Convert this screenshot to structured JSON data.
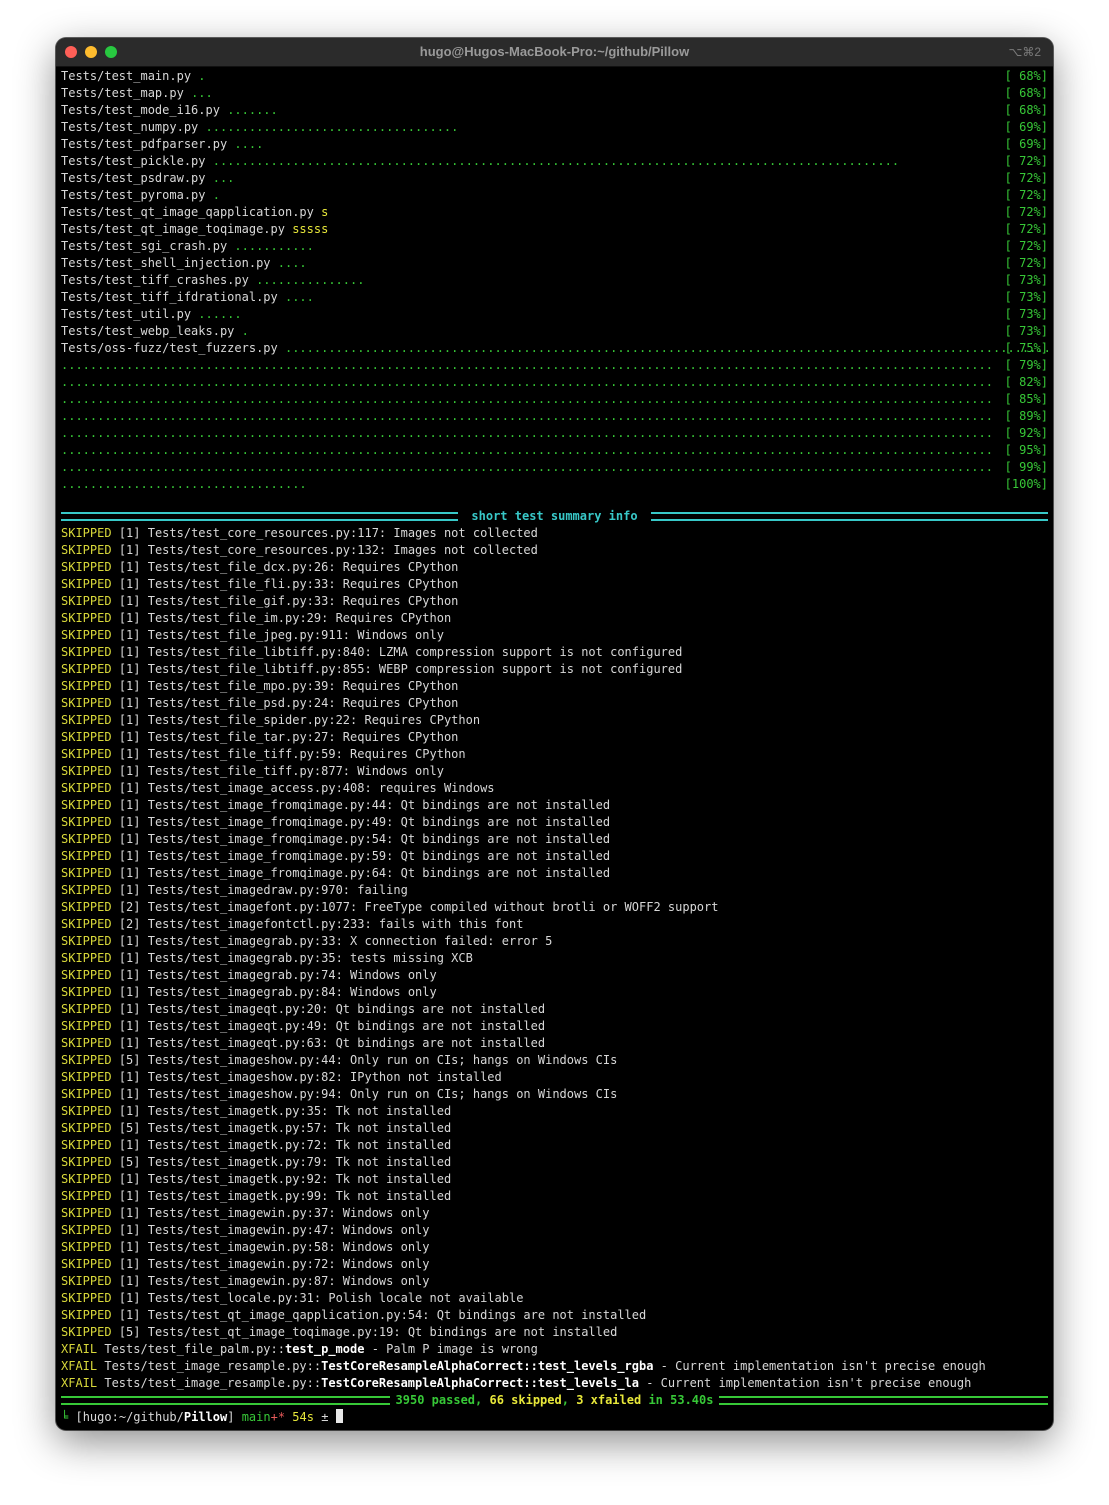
{
  "window": {
    "title": "hugo@Hugos-MacBook-Pro:~/github/Pillow",
    "shortcut": "⌥⌘2"
  },
  "progress": [
    {
      "file": "Tests/test_main.py",
      "marks": ".",
      "pct": "[ 68%]"
    },
    {
      "file": "Tests/test_map.py",
      "marks": "...",
      "pct": "[ 68%]"
    },
    {
      "file": "Tests/test_mode_i16.py",
      "marks": ".......",
      "pct": "[ 68%]"
    },
    {
      "file": "Tests/test_numpy.py",
      "marks": "...................................",
      "pct": "[ 69%]"
    },
    {
      "file": "Tests/test_pdfparser.py",
      "marks": "....",
      "pct": "[ 69%]"
    },
    {
      "file": "Tests/test_pickle.py",
      "marks": "...............................................................................................",
      "pct": "[ 72%]"
    },
    {
      "file": "Tests/test_psdraw.py",
      "marks": "...",
      "pct": "[ 72%]"
    },
    {
      "file": "Tests/test_pyroma.py",
      "marks": ".",
      "pct": "[ 72%]"
    },
    {
      "file": "Tests/test_qt_image_qapplication.py",
      "marks": "s",
      "pct": "[ 72%]",
      "skip": true
    },
    {
      "file": "Tests/test_qt_image_toqimage.py",
      "marks": "sssss",
      "pct": "[ 72%]",
      "skip": true
    },
    {
      "file": "Tests/test_sgi_crash.py",
      "marks": "...........",
      "pct": "[ 72%]"
    },
    {
      "file": "Tests/test_shell_injection.py",
      "marks": "....",
      "pct": "[ 72%]"
    },
    {
      "file": "Tests/test_tiff_crashes.py",
      "marks": "...............",
      "pct": "[ 73%]"
    },
    {
      "file": "Tests/test_tiff_ifdrational.py",
      "marks": "....",
      "pct": "[ 73%]"
    },
    {
      "file": "Tests/test_util.py",
      "marks": "......",
      "pct": "[ 73%]"
    },
    {
      "file": "Tests/test_webp_leaks.py",
      "marks": ".",
      "pct": "[ 73%]"
    },
    {
      "file": "Tests/oss-fuzz/test_fuzzers.py",
      "marks": "...........................................................................................................",
      "pct": "[ 75%]"
    }
  ],
  "fuzz_lines": [
    {
      "pct": "[ 79%]"
    },
    {
      "pct": "[ 82%]"
    },
    {
      "pct": "[ 85%]"
    },
    {
      "pct": "[ 89%]"
    },
    {
      "pct": "[ 92%]"
    },
    {
      "pct": "[ 95%]"
    },
    {
      "pct": "[ 99%]"
    }
  ],
  "fuzz_last": {
    "marks": "..................................",
    "pct": "[100%]"
  },
  "summary_header": " short test summary info ",
  "skipped_label": "SKIPPED",
  "skipped": [
    {
      "count": "[1]",
      "text": "Tests/test_core_resources.py:117: Images not collected"
    },
    {
      "count": "[1]",
      "text": "Tests/test_core_resources.py:132: Images not collected"
    },
    {
      "count": "[1]",
      "text": "Tests/test_file_dcx.py:26: Requires CPython"
    },
    {
      "count": "[1]",
      "text": "Tests/test_file_fli.py:33: Requires CPython"
    },
    {
      "count": "[1]",
      "text": "Tests/test_file_gif.py:33: Requires CPython"
    },
    {
      "count": "[1]",
      "text": "Tests/test_file_im.py:29: Requires CPython"
    },
    {
      "count": "[1]",
      "text": "Tests/test_file_jpeg.py:911: Windows only"
    },
    {
      "count": "[1]",
      "text": "Tests/test_file_libtiff.py:840: LZMA compression support is not configured"
    },
    {
      "count": "[1]",
      "text": "Tests/test_file_libtiff.py:855: WEBP compression support is not configured"
    },
    {
      "count": "[1]",
      "text": "Tests/test_file_mpo.py:39: Requires CPython"
    },
    {
      "count": "[1]",
      "text": "Tests/test_file_psd.py:24: Requires CPython"
    },
    {
      "count": "[1]",
      "text": "Tests/test_file_spider.py:22: Requires CPython"
    },
    {
      "count": "[1]",
      "text": "Tests/test_file_tar.py:27: Requires CPython"
    },
    {
      "count": "[1]",
      "text": "Tests/test_file_tiff.py:59: Requires CPython"
    },
    {
      "count": "[1]",
      "text": "Tests/test_file_tiff.py:877: Windows only"
    },
    {
      "count": "[1]",
      "text": "Tests/test_image_access.py:408: requires Windows"
    },
    {
      "count": "[1]",
      "text": "Tests/test_image_fromqimage.py:44: Qt bindings are not installed"
    },
    {
      "count": "[1]",
      "text": "Tests/test_image_fromqimage.py:49: Qt bindings are not installed"
    },
    {
      "count": "[1]",
      "text": "Tests/test_image_fromqimage.py:54: Qt bindings are not installed"
    },
    {
      "count": "[1]",
      "text": "Tests/test_image_fromqimage.py:59: Qt bindings are not installed"
    },
    {
      "count": "[1]",
      "text": "Tests/test_image_fromqimage.py:64: Qt bindings are not installed"
    },
    {
      "count": "[1]",
      "text": "Tests/test_imagedraw.py:970: failing"
    },
    {
      "count": "[2]",
      "text": "Tests/test_imagefont.py:1077: FreeType compiled without brotli or WOFF2 support"
    },
    {
      "count": "[2]",
      "text": "Tests/test_imagefontctl.py:233: fails with this font"
    },
    {
      "count": "[1]",
      "text": "Tests/test_imagegrab.py:33: X connection failed: error 5"
    },
    {
      "count": "[1]",
      "text": "Tests/test_imagegrab.py:35: tests missing XCB"
    },
    {
      "count": "[1]",
      "text": "Tests/test_imagegrab.py:74: Windows only"
    },
    {
      "count": "[1]",
      "text": "Tests/test_imagegrab.py:84: Windows only"
    },
    {
      "count": "[1]",
      "text": "Tests/test_imageqt.py:20: Qt bindings are not installed"
    },
    {
      "count": "[1]",
      "text": "Tests/test_imageqt.py:49: Qt bindings are not installed"
    },
    {
      "count": "[1]",
      "text": "Tests/test_imageqt.py:63: Qt bindings are not installed"
    },
    {
      "count": "[5]",
      "text": "Tests/test_imageshow.py:44: Only run on CIs; hangs on Windows CIs"
    },
    {
      "count": "[1]",
      "text": "Tests/test_imageshow.py:82: IPython not installed"
    },
    {
      "count": "[1]",
      "text": "Tests/test_imageshow.py:94: Only run on CIs; hangs on Windows CIs"
    },
    {
      "count": "[1]",
      "text": "Tests/test_imagetk.py:35: Tk not installed"
    },
    {
      "count": "[5]",
      "text": "Tests/test_imagetk.py:57: Tk not installed"
    },
    {
      "count": "[1]",
      "text": "Tests/test_imagetk.py:72: Tk not installed"
    },
    {
      "count": "[5]",
      "text": "Tests/test_imagetk.py:79: Tk not installed"
    },
    {
      "count": "[1]",
      "text": "Tests/test_imagetk.py:92: Tk not installed"
    },
    {
      "count": "[1]",
      "text": "Tests/test_imagetk.py:99: Tk not installed"
    },
    {
      "count": "[1]",
      "text": "Tests/test_imagewin.py:37: Windows only"
    },
    {
      "count": "[1]",
      "text": "Tests/test_imagewin.py:47: Windows only"
    },
    {
      "count": "[1]",
      "text": "Tests/test_imagewin.py:58: Windows only"
    },
    {
      "count": "[1]",
      "text": "Tests/test_imagewin.py:72: Windows only"
    },
    {
      "count": "[1]",
      "text": "Tests/test_imagewin.py:87: Windows only"
    },
    {
      "count": "[1]",
      "text": "Tests/test_locale.py:31: Polish locale not available"
    },
    {
      "count": "[1]",
      "text": "Tests/test_qt_image_qapplication.py:54: Qt bindings are not installed"
    },
    {
      "count": "[5]",
      "text": "Tests/test_qt_image_toqimage.py:19: Qt bindings are not installed"
    }
  ],
  "xfail_label": "XFAIL",
  "xfail": [
    {
      "path": "Tests/test_file_palm.py::",
      "name": "test_p_mode",
      "reason": " - Palm P image is wrong"
    },
    {
      "path": "Tests/test_image_resample.py::",
      "name": "TestCoreResampleAlphaCorrect::test_levels_rgba",
      "reason": " - Current implementation isn't precise enough"
    },
    {
      "path": "Tests/test_image_resample.py::",
      "name": "TestCoreResampleAlphaCorrect::test_levels_la",
      "reason": " - Current implementation isn't precise enough"
    }
  ],
  "result": {
    "passed": "3950 passed",
    "sep1": ", ",
    "skipped": "66 skipped",
    "sep2": ", ",
    "xfailed": "3 xfailed",
    "time": " in 53.40s"
  },
  "prompt": {
    "glyph": "╘",
    "open": "[",
    "user": "hugo",
    "colon": ":",
    "path": "~/github/",
    "dir": "Pillow",
    "close": "]",
    "branch": "main",
    "star": "+*",
    "time": "54s",
    "suffix": "±"
  }
}
